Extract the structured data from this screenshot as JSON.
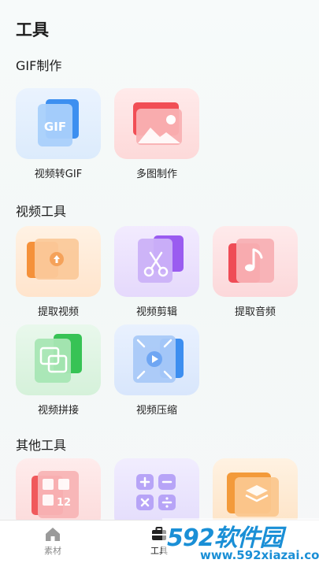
{
  "page": {
    "title": "工具"
  },
  "sections": {
    "gif": {
      "title": "GIF制作"
    },
    "video": {
      "title": "视频工具"
    },
    "other": {
      "title": "其他工具"
    }
  },
  "tools": {
    "video_to_gif": {
      "label": "视频转GIF",
      "icon": "file-gif-icon",
      "color": "#4aa3f0",
      "tile_bg": "#e6f1fd"
    },
    "multi_image": {
      "label": "多图制作",
      "icon": "image-icon",
      "color": "#f2555a",
      "tile_bg": "#ffe7e7"
    },
    "extract_video": {
      "label": "提取视频",
      "icon": "upload-icon",
      "color": "#f5913a",
      "tile_bg": "#fff0e2"
    },
    "video_edit": {
      "label": "视频剪辑",
      "icon": "scissors-icon",
      "color": "#9a5cf0",
      "tile_bg": "#f0e9fd"
    },
    "extract_audio": {
      "label": "提取音频",
      "icon": "music-note-icon",
      "color": "#ef4c56",
      "tile_bg": "#fde7e8"
    },
    "video_stitch": {
      "label": "视频拼接",
      "icon": "merge-icon",
      "color": "#3ec65a",
      "tile_bg": "#e5f7e8"
    },
    "video_compress": {
      "label": "视频压缩",
      "icon": "compress-icon",
      "color": "#3d8ef0",
      "tile_bg": "#e6effd"
    },
    "other_1": {
      "label": "",
      "icon": "number-grid-icon",
      "color": "#f0595c",
      "tile_bg": "#fde8e8"
    },
    "other_2": {
      "label": "",
      "icon": "calculator-icon",
      "color": "#8e6cf2",
      "tile_bg": "#eeeafd"
    },
    "other_3": {
      "label": "",
      "icon": "layers-icon",
      "color": "#f39a3a",
      "tile_bg": "#fff0dc"
    }
  },
  "tab_bar": {
    "items": [
      {
        "label": "素材",
        "icon": "home-icon",
        "active": false
      },
      {
        "label": "工具",
        "icon": "toolbox-icon",
        "active": true
      }
    ]
  },
  "watermark": {
    "big": "592软件园",
    "small": "www.592xiazai.com"
  }
}
